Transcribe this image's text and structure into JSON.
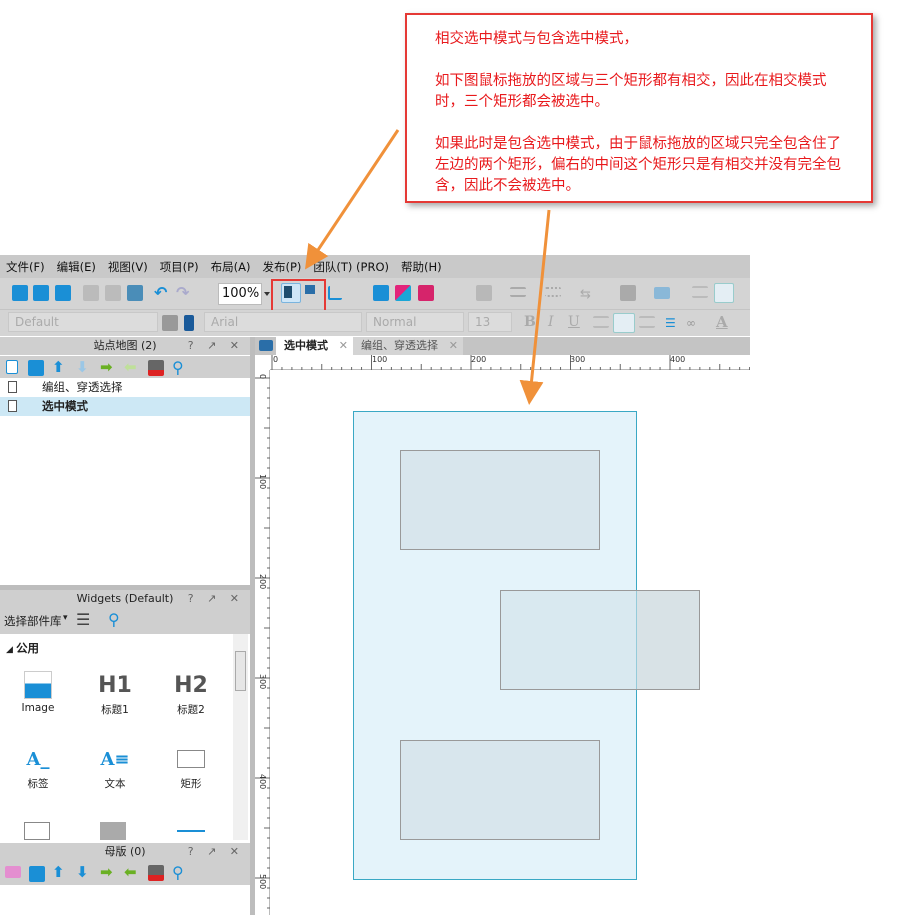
{
  "annotation": {
    "line1": "相交选中模式与包含选中模式，",
    "para2": "如下图鼠标拖放的区域与三个矩形都有相交，因此在相交模式时，三个矩形都会被选中。",
    "para3": "如果此时是包含选中模式，由于鼠标拖放的区域只完全包含住了左边的两个矩形，偏右的中间这个矩形只是有相交并没有完全包含，因此不会被选中。",
    "border_color": "#e53935",
    "arrow_color": "#f0913a"
  },
  "menu": [
    "文件(F)",
    "编辑(E)",
    "视图(V)",
    "项目(P)",
    "布局(A)",
    "发布(P)",
    "团队(T) (PRO)",
    "帮助(H)"
  ],
  "toolbar": {
    "zoom": "100%",
    "style_select": "Default",
    "font_select": "Arial",
    "weight_select": "Normal",
    "size_select": "13",
    "bold": "B",
    "italic": "I",
    "underline": "U",
    "font_color": "A",
    "active_tool": "intersect-select-mode"
  },
  "sitemap": {
    "title": "站点地图 (2)",
    "controls": "? ↗ ✕",
    "pages": [
      {
        "label": "编组、穿透选择",
        "selected": false
      },
      {
        "label": "选中模式",
        "selected": true
      }
    ]
  },
  "widgets": {
    "title": "Widgets (Default)",
    "controls": "? ↗ ✕",
    "library_select": "选择部件库",
    "section": "公用",
    "items": [
      {
        "glyph": "",
        "label": "Image"
      },
      {
        "glyph": "H1",
        "label": "标题1"
      },
      {
        "glyph": "H2",
        "label": "标题2"
      },
      {
        "glyph": "A_",
        "label": "标签"
      },
      {
        "glyph": "A≡",
        "label": "文本"
      },
      {
        "glyph": "",
        "label": "矩形"
      }
    ]
  },
  "masters": {
    "title": "母版 (0)",
    "controls": "? ↗ ✕"
  },
  "tabs": [
    {
      "label": "选中模式",
      "active": true
    },
    {
      "label": "编组、穿透选择",
      "active": false
    }
  ],
  "ruler": {
    "top": [
      "0",
      "100",
      "200",
      "300",
      "400"
    ],
    "left": [
      "0",
      "100",
      "200",
      "300",
      "400",
      "500"
    ]
  }
}
